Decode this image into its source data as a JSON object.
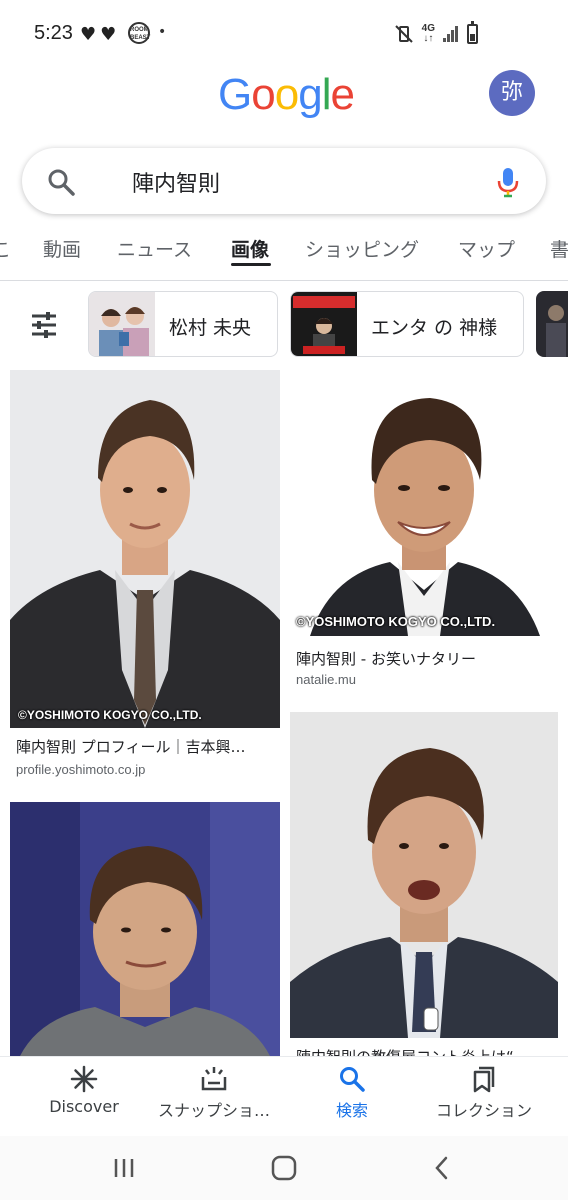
{
  "status_bar": {
    "time": "5:23",
    "hearts": "♥♥",
    "app_badge": "ROOM BEAST",
    "dot": "•",
    "network": "4G"
  },
  "header": {
    "logo_letters": [
      {
        "char": "G",
        "color": "#4285F4"
      },
      {
        "char": "o",
        "color": "#EA4335"
      },
      {
        "char": "o",
        "color": "#FBBC05"
      },
      {
        "char": "g",
        "color": "#4285F4"
      },
      {
        "char": "l",
        "color": "#34A853"
      },
      {
        "char": "e",
        "color": "#EA4335"
      }
    ],
    "avatar_initial": "弥"
  },
  "search": {
    "query": "陣内智則"
  },
  "tabs": [
    {
      "label": "こ"
    },
    {
      "label": "動画"
    },
    {
      "label": "ニュース"
    },
    {
      "label": "画像",
      "active": true
    },
    {
      "label": "ショッピング"
    },
    {
      "label": "マップ"
    },
    {
      "label": "書"
    }
  ],
  "chips": [
    {
      "label": "松村 未央",
      "icon": "sliders-icon"
    },
    {
      "label": "エンタ の 神様"
    }
  ],
  "results": [
    {
      "caption": "陣内智則 プロフィール｜吉本興…",
      "source": "profile.yoshimoto.co.jp",
      "watermark": "©YOSHIMOTO KOGYO CO.,LTD."
    },
    {
      "caption": "陣内智則 - お笑いナタリー",
      "source": "natalie.mu",
      "watermark": "©YOSHIMOTO KOGYO CO.,LTD."
    },
    {
      "caption": "",
      "source": ""
    },
    {
      "caption": "陣内智則の教傷屋コント炎上は“",
      "source": ""
    }
  ],
  "bottom_nav": [
    {
      "label": "Discover",
      "icon": "asterisk-icon"
    },
    {
      "label": "スナップショ…",
      "icon": "snapshot-icon"
    },
    {
      "label": "検索",
      "icon": "search-icon",
      "active": true
    },
    {
      "label": "コレクション",
      "icon": "collections-icon"
    }
  ],
  "colors": {
    "accent": "#1a73e8",
    "avatar": "#5c6bc0",
    "mic_blue": "#4285F4",
    "mic_red": "#EA4335"
  }
}
